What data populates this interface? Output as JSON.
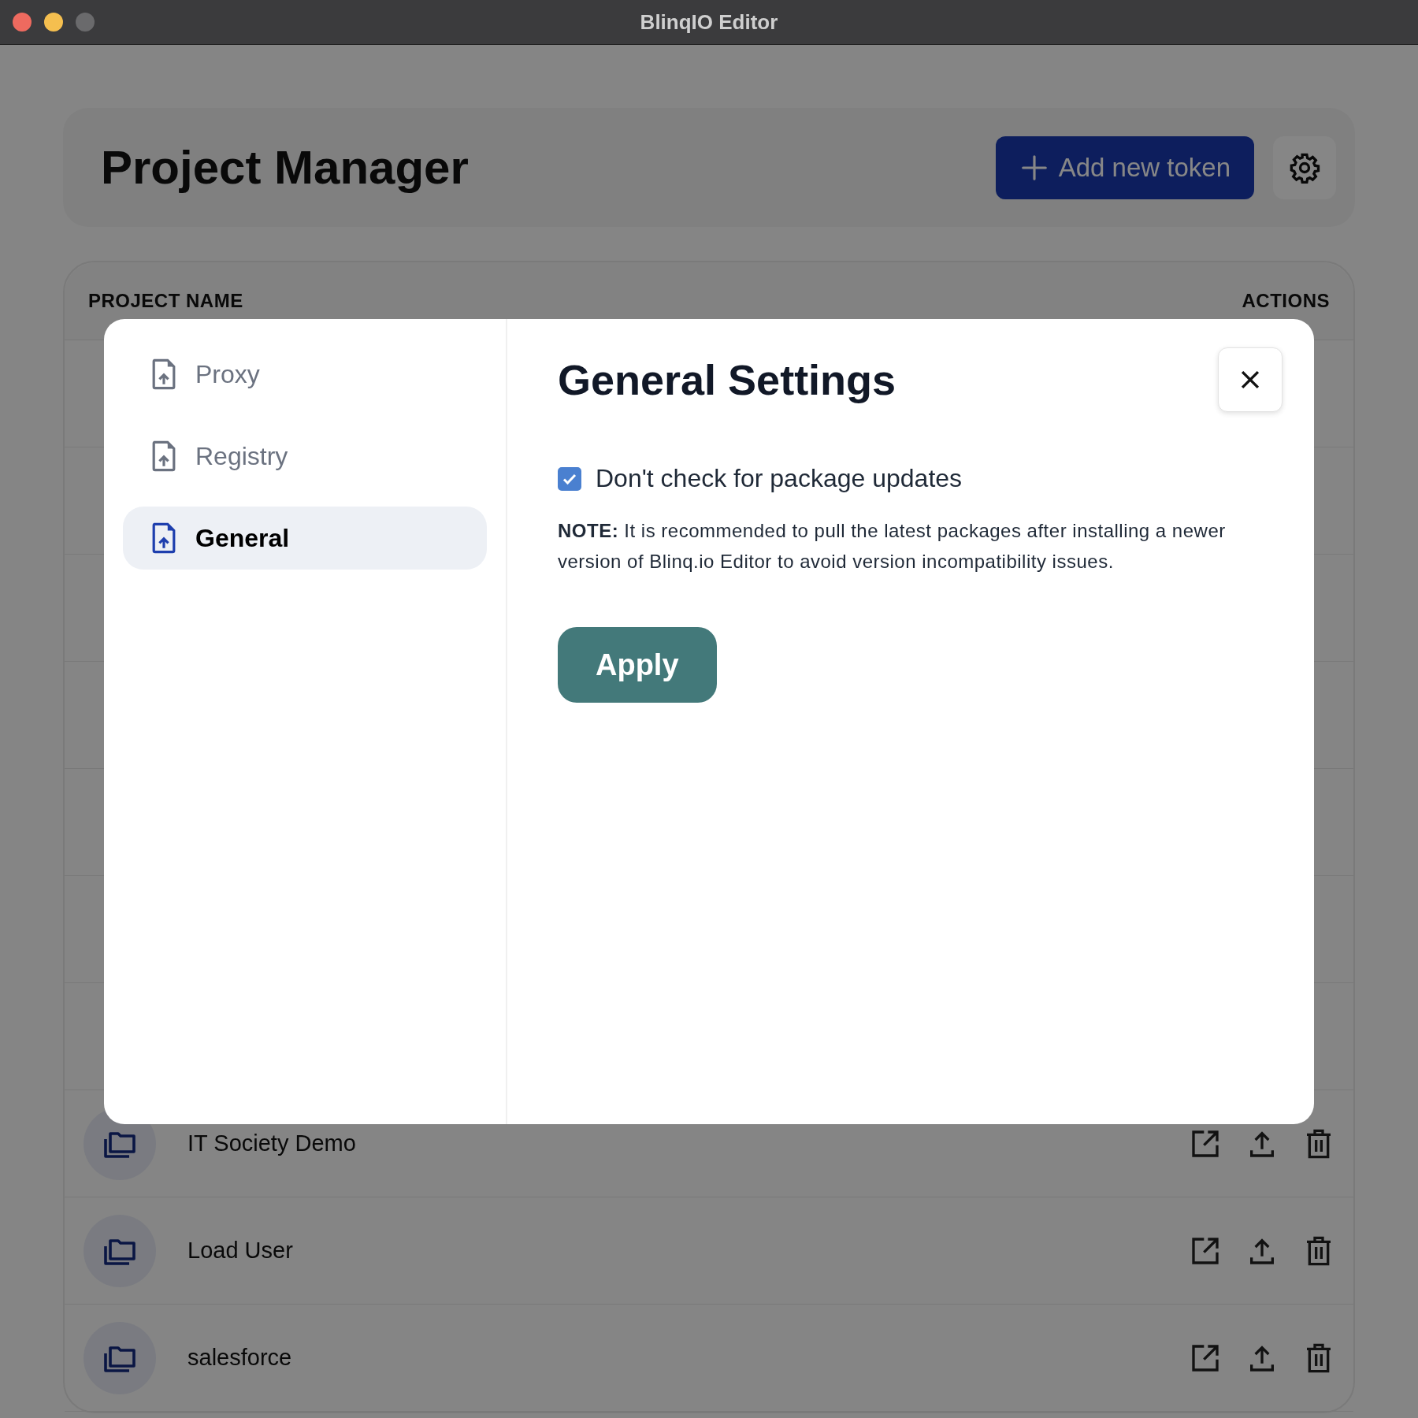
{
  "window": {
    "title": "BlinqIO Editor"
  },
  "header": {
    "title": "Project Manager",
    "add_button": "Add new token"
  },
  "table": {
    "columns": [
      "PROJECT NAME",
      "ACTIONS"
    ],
    "rows": [
      {
        "name": "IT Society Demo"
      },
      {
        "name": "Load User"
      },
      {
        "name": "salesforce"
      }
    ]
  },
  "dialog": {
    "nav": [
      {
        "label": "Proxy",
        "selected": false
      },
      {
        "label": "Registry",
        "selected": false
      },
      {
        "label": "General",
        "selected": true
      }
    ],
    "title": "General Settings",
    "option": {
      "label": "Don't check for package updates",
      "checked": true
    },
    "note": "**NOTE:** It is recommended to pull the latest packages after installing a newer version of Blinq.io Editor to avoid version incompatibility issues.",
    "apply": "Apply"
  }
}
